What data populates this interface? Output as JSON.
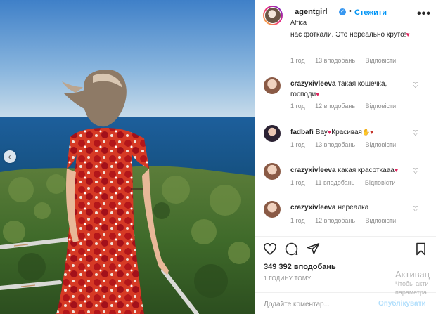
{
  "post": {
    "username": "_agentgirl_",
    "verified_mark": "✓",
    "separator": "•",
    "follow_label": "Стежити",
    "location": "Africa",
    "more_label": "•••",
    "carousel_prev_label": "‹"
  },
  "comments": {
    "first": {
      "text": "нас фоткали. Это нереально круто!",
      "emoji": "♥",
      "meta": {
        "time": "1 год",
        "likes": "13 вподобань",
        "reply": "Відповісти"
      }
    },
    "items": [
      {
        "user": "crazyxivleeva",
        "text": "такая кошечка, господи",
        "emoji": "♥",
        "time": "1 год",
        "likes": "12 вподобань",
        "reply": "Відповісти"
      },
      {
        "user": "fadbafi",
        "text": "Вау",
        "emoji": "♥",
        "text2": "Красивая",
        "emoji2": "✋♥",
        "time": "1 год",
        "likes": "13 вподобань",
        "reply": "Відповісти"
      },
      {
        "user": "crazyxivleeva",
        "text": "какая красоткааа",
        "emoji": "♥",
        "time": "1 год",
        "likes": "11 вподобань",
        "reply": "Відповісти"
      },
      {
        "user": "crazyxivleeva",
        "text": "нереалка",
        "emoji": "",
        "time": "1 год",
        "likes": "12 вподобань",
        "reply": "Відповісти"
      }
    ]
  },
  "actions": {
    "like_icon": "heart-outline-icon",
    "comment_icon": "comment-icon",
    "share_icon": "paper-plane-icon",
    "save_icon": "bookmark-icon"
  },
  "likes_text": "349 392 вподобань",
  "time_ago": "1 ГОДИНУ ТОМУ",
  "add_comment": {
    "placeholder": "Додайте коментар...",
    "post_label": "Опублікувати"
  },
  "watermark": {
    "title": "Активац",
    "line1": "Чтобы акти",
    "line2": "параметра"
  },
  "colors": {
    "accent": "#0095f6",
    "text": "#262626",
    "muted": "#8e8e8e",
    "heart": "#e0245e"
  }
}
